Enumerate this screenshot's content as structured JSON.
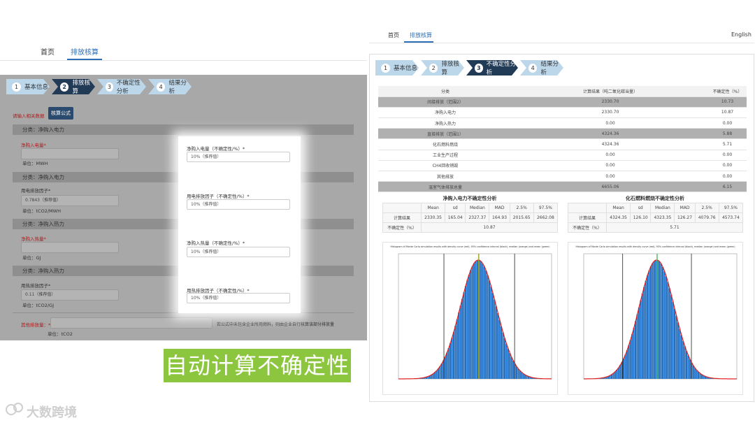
{
  "left_nav": {
    "home": "首页",
    "emission": "排放核算"
  },
  "right_nav": {
    "home": "首页",
    "emission": "排放核算",
    "language": "English"
  },
  "steps": [
    {
      "num": "1",
      "label": "基本信息"
    },
    {
      "num": "2",
      "label": "排放核算"
    },
    {
      "num": "3",
      "label": "不确定性分析"
    },
    {
      "num": "4",
      "label": "结果分析"
    }
  ],
  "left_form": {
    "prompt": "请输入相关数据",
    "formula_button": "核算公式",
    "sections": [
      {
        "title": "分类：净购入电力",
        "field_label": "净购入电量*",
        "unit": "单位：MWH",
        "value": "",
        "unc_label": "净购入电量（不确定性/%）*",
        "unc_value": "10%（推荐值）"
      },
      {
        "title": "分类：净购入电力",
        "field_label": "用电排放因子*",
        "unit": "单位：tCO2/MWH",
        "value": "0.7843（推荐值）",
        "unc_label": "用电排放因子（不确定性/%）*",
        "unc_value": "10%（推荐值）"
      },
      {
        "title": "分类：净购入热力",
        "field_label": "净购入热量*",
        "unit": "单位：GJ",
        "value": "",
        "unc_label": "净购入热量（不确定性/%）*",
        "unc_value": "10%（推荐值）"
      },
      {
        "title": "分类：净购入热力",
        "field_label": "用热排放因子*",
        "unit": "单位：tCO2/GJ",
        "value": "0.11（推荐值）",
        "unc_label": "用热排放因子（不确定性/%）*",
        "unc_value": "10%（推荐值）"
      }
    ],
    "other_label": "其他排放量：*",
    "other_note": "若公式中未包含企业所用燃料，则由企业自行核算该部分排放量",
    "other_unit": "单位：tCO2"
  },
  "banner": "自动计算不确定性",
  "watermark": "大数跨境",
  "summary_table": {
    "headers": [
      "分类",
      "计算结果（吨二氧化碳当量）",
      "不确定性（%）"
    ],
    "rows": [
      {
        "cat": "间接排放（范围2）",
        "val": "2330.70",
        "unc": "10.73",
        "grey": true
      },
      {
        "cat": "净购入电力",
        "val": "2330.70",
        "unc": "10.87",
        "grey": false
      },
      {
        "cat": "净购入热力",
        "val": "0.00",
        "unc": "0.00",
        "grey": false
      },
      {
        "cat": "直接排放（范围1）",
        "val": "4324.36",
        "unc": "5.88",
        "grey": true
      },
      {
        "cat": "化石燃料燃烧",
        "val": "4324.36",
        "unc": "5.71",
        "grey": false
      },
      {
        "cat": "工业生产过程",
        "val": "0.00",
        "unc": "0.00",
        "grey": false
      },
      {
        "cat": "CH4回收销毁",
        "val": "0.00",
        "unc": "0.00",
        "grey": false
      },
      {
        "cat": "其他排放",
        "val": "0.00",
        "unc": "0.00",
        "grey": false
      },
      {
        "cat": "温室气体排放总量",
        "val": "6655.06",
        "unc": "6.15",
        "grey": true
      }
    ]
  },
  "analyses": [
    {
      "title": "净购入电力不确定性分析",
      "headers": [
        "Mean",
        "sd",
        "Median",
        "MAD",
        "2.5%",
        "97.5%"
      ],
      "result_label": "计算结果",
      "values": [
        "2330.35",
        "165.04",
        "2327.37",
        "164.93",
        "2015.65",
        "2662.08"
      ],
      "unc_label": "不确定性（%）",
      "unc_value": "10.87"
    },
    {
      "title": "化石燃料燃烧不确定性分析",
      "headers": [
        "Mean",
        "sd",
        "Median",
        "MAD",
        "2.5%",
        "97.5%"
      ],
      "result_label": "计算结果",
      "values": [
        "4324.35",
        "126.10",
        "4323.35",
        "126.27",
        "4079.76",
        "4573.74"
      ],
      "unc_label": "不确定性（%）",
      "unc_value": "5.71"
    }
  ],
  "chart_data": [
    {
      "type": "bar",
      "title": "Histogram of Monte Carlo simulation results with density curve (red), 95% confidence interval (black), median (orange) and mean (green)",
      "mean": 2330.35,
      "sd": 165.04,
      "ci": [
        2015.65,
        2662.08
      ],
      "xlim": [
        1600,
        3000
      ],
      "bar_color": "#1f6fc4",
      "curve_color": "#e02020"
    },
    {
      "type": "bar",
      "title": "Histogram of Monte Carlo simulation results with density curve (red), 95% confidence interval (black), median (orange) and mean (green)",
      "mean": 4324.35,
      "sd": 126.1,
      "ci": [
        4079.76,
        4573.74
      ],
      "xlim": [
        3800,
        4900
      ],
      "bar_color": "#1f6fc4",
      "curve_color": "#e02020"
    }
  ]
}
